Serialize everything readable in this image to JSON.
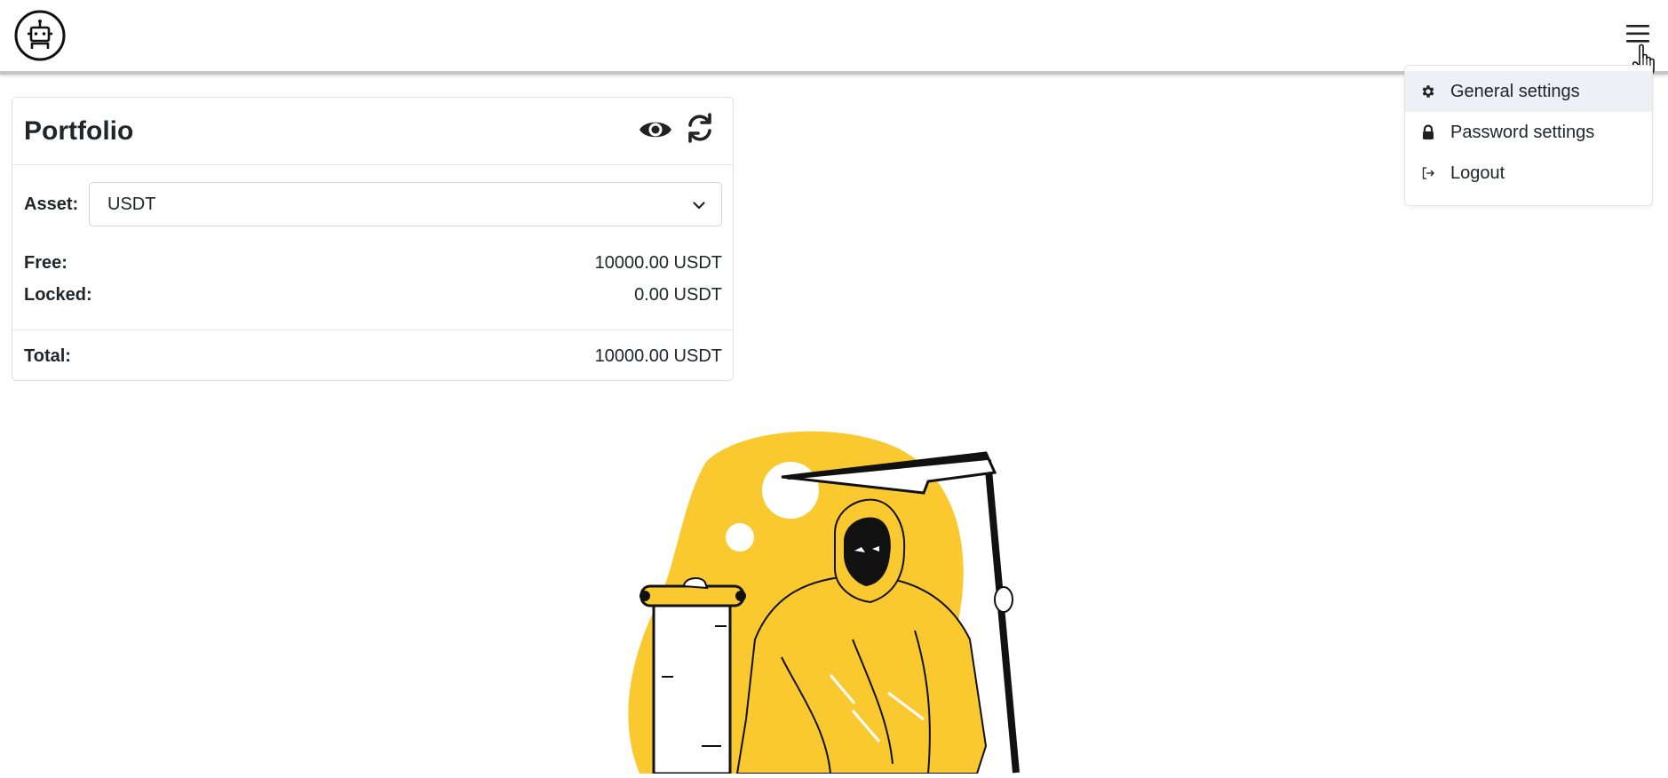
{
  "header": {
    "logo_icon": "robot-logo-icon",
    "menu_icon": "hamburger-menu-icon"
  },
  "menu": {
    "items": [
      {
        "label": "General settings",
        "icon": "gear-icon",
        "active": true
      },
      {
        "label": "Password settings",
        "icon": "lock-icon",
        "active": false
      },
      {
        "label": "Logout",
        "icon": "logout-icon",
        "active": false
      }
    ]
  },
  "portfolio": {
    "title": "Portfolio",
    "actions": [
      "eye-icon",
      "refresh-icon"
    ],
    "asset_label": "Asset:",
    "asset_value": "USDT",
    "free_label": "Free:",
    "free_value": "10000.00 USDT",
    "locked_label": "Locked:",
    "locked_value": "0.00 USDT",
    "total_label": "Total:",
    "total_value": "10000.00 USDT"
  },
  "colors": {
    "accent_yellow": "#f9c92f",
    "text_dark": "#212529",
    "menu_active_bg": "#edf1f5"
  }
}
